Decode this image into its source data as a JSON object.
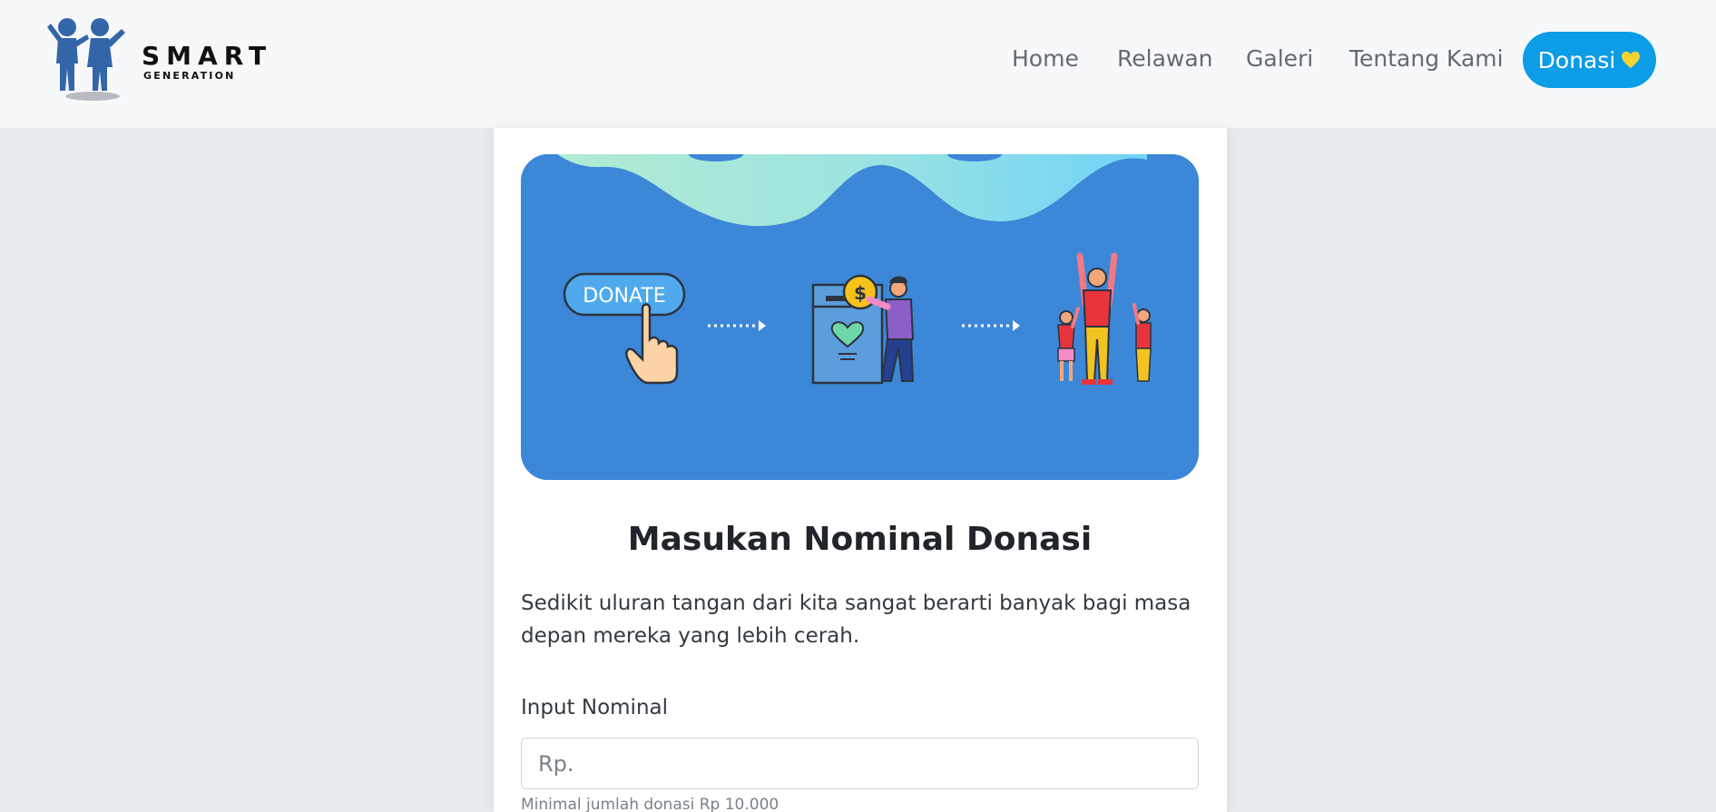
{
  "brand": {
    "line1": "SMART",
    "line2": "GENERATION",
    "logo_icon": "children-icon"
  },
  "nav": {
    "items": [
      "Home",
      "Relawan",
      "Galeri",
      "Tentang Kami"
    ],
    "cta_label": "Donasi",
    "cta_icon": "yellow-heart-icon",
    "colors": {
      "cta_bg": "#0d9ce6",
      "text": "#666a6e"
    }
  },
  "banner": {
    "button_text": "DONATE",
    "colors": {
      "background": "#3c87d7",
      "wave_start": "#a8ecd6",
      "wave_end": "#72d4f6"
    }
  },
  "form": {
    "title": "Masukan Nominal Donasi",
    "description": "Sedikit uluran tangan dari kita sangat berarti banyak bagi masa depan mereka yang lebih cerah.",
    "input_label": "Input Nominal",
    "input_placeholder": "Rp.",
    "input_value": "",
    "help": "Minimal jumlah donasi Rp 10.000"
  }
}
